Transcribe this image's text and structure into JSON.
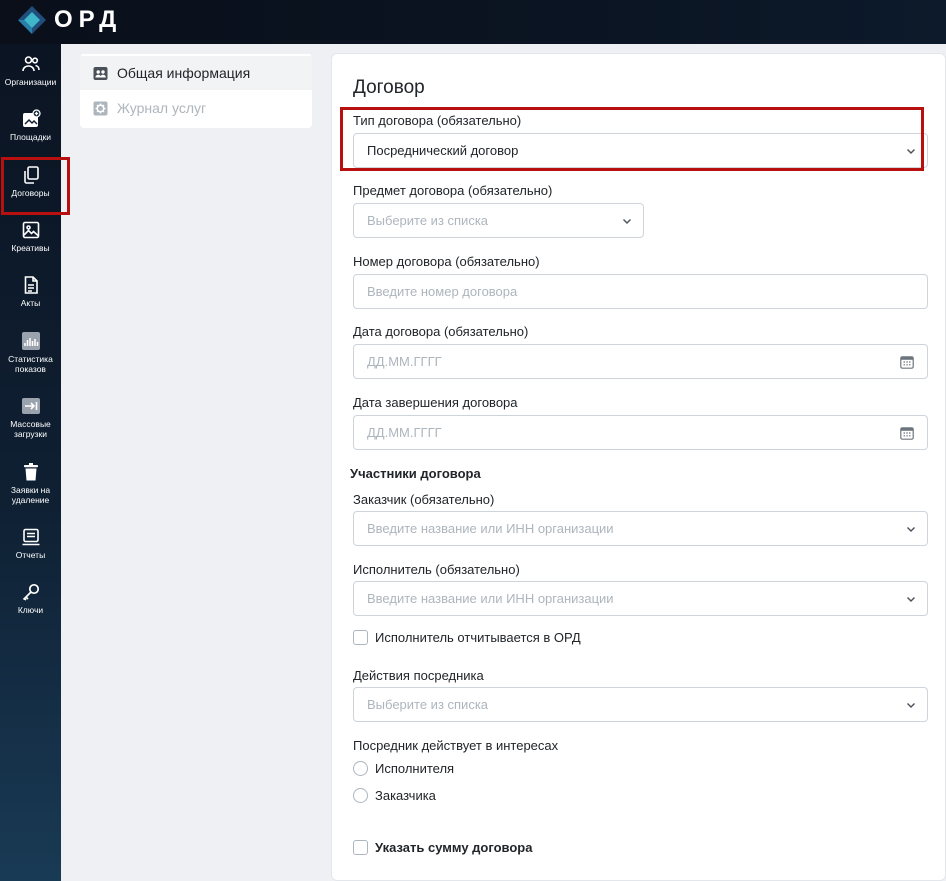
{
  "app": {
    "logo_text": "ОРД",
    "brand_colors": {
      "logo_dark": "#1f4f7a",
      "logo_light": "#3fb6c9",
      "highlight": "#b80f0f"
    }
  },
  "sidebar": {
    "items": [
      {
        "label": "Организации",
        "icon": "people-icon"
      },
      {
        "label": "Площадки",
        "icon": "platform-add-icon"
      },
      {
        "label": "Договоры",
        "icon": "copy-documents-icon"
      },
      {
        "label": "Креативы",
        "icon": "image-icon"
      },
      {
        "label": "Акты",
        "icon": "document-icon"
      },
      {
        "label": "Статистика показов",
        "icon": "statistics-icon"
      },
      {
        "label": "Массовые загрузки",
        "icon": "bulk-upload-icon"
      },
      {
        "label": "Заявки на удаление",
        "icon": "trash-icon"
      },
      {
        "label": "Отчеты",
        "icon": "report-icon"
      },
      {
        "label": "Ключи",
        "icon": "key-icon"
      }
    ]
  },
  "tabs": [
    {
      "label": "Общая информация",
      "icon": "contacts-icon",
      "active": true
    },
    {
      "label": "Журнал услуг",
      "icon": "gear-icon",
      "active": false
    }
  ],
  "form": {
    "title": "Договор",
    "contract_type": {
      "label": "Тип договора (обязательно)",
      "value": "Посреднический договор"
    },
    "contract_subject": {
      "label": "Предмет договора (обязательно)",
      "placeholder": "Выберите из списка"
    },
    "contract_number": {
      "label": "Номер договора (обязательно)",
      "placeholder": "Введите номер договора"
    },
    "contract_date": {
      "label": "Дата договора (обязательно)",
      "placeholder": "ДД.ММ.ГГГГ"
    },
    "contract_end_date": {
      "label": "Дата завершения договора",
      "placeholder": "ДД.ММ.ГГГГ"
    },
    "participants_title": "Участники договора",
    "customer": {
      "label": "Заказчик (обязательно)",
      "placeholder": "Введите название или ИНН организации"
    },
    "executor": {
      "label": "Исполнитель (обязательно)",
      "placeholder": "Введите название или ИНН организации"
    },
    "executor_reports_label": "Исполнитель отчитывается в ОРД",
    "intermediary_actions": {
      "label": "Действия посредника",
      "placeholder": "Выберите из списка"
    },
    "intermediary_interest": {
      "label": "Посредник действует в интересах",
      "options": [
        "Исполнителя",
        "Заказчика"
      ]
    },
    "specify_amount_label": "Указать сумму договора"
  }
}
